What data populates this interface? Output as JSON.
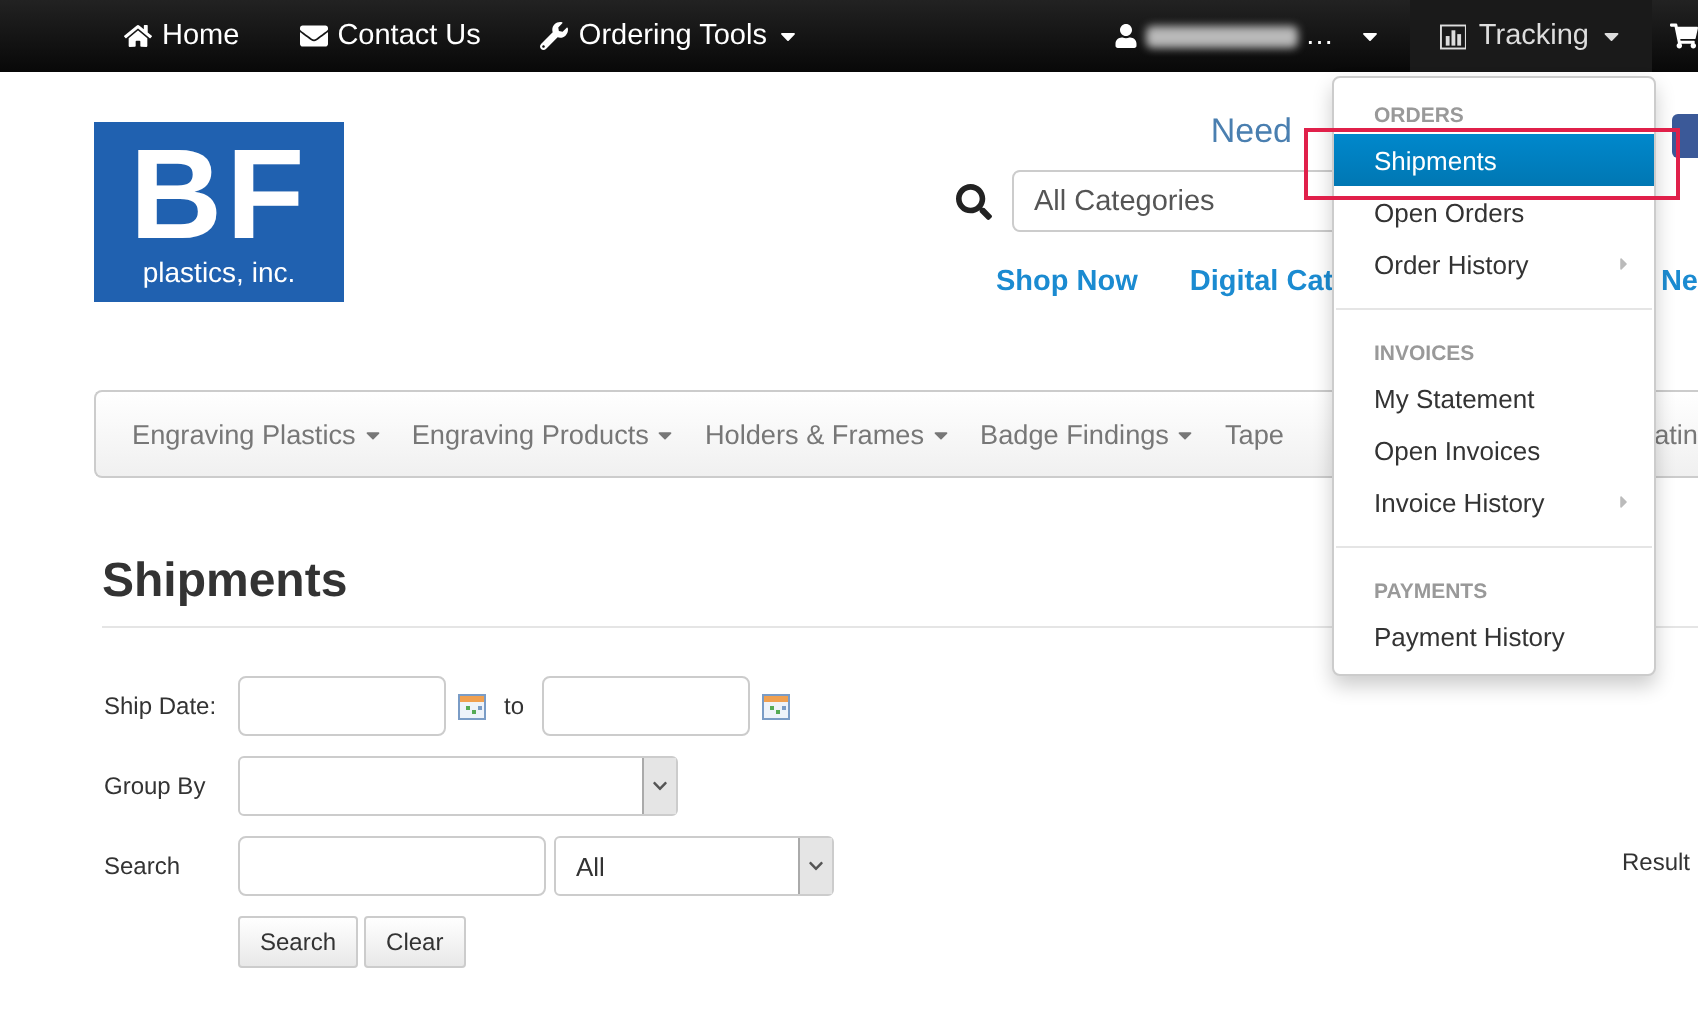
{
  "top_nav": {
    "left": [
      {
        "label": "Home",
        "caret": false
      },
      {
        "label": "Contact Us",
        "caret": false
      },
      {
        "label": "Ordering Tools",
        "caret": true
      }
    ],
    "user": {
      "name": "…"
    },
    "tracking": {
      "label": "Tracking",
      "expanded": true
    }
  },
  "header": {
    "logo": {
      "mark": "BF",
      "name": "plastics, inc."
    },
    "notice": "Need",
    "search_select": "All Categories",
    "links": [
      {
        "label": "Shop Now"
      },
      {
        "label": "Digital Cat"
      },
      {
        "label": "Ne"
      }
    ]
  },
  "category_nav": {
    "items": [
      {
        "label": "Engraving Plastics",
        "caret": true
      },
      {
        "label": "Engraving Products",
        "caret": true
      },
      {
        "label": "Holders & Frames",
        "caret": true
      },
      {
        "label": "Badge Findings",
        "caret": true
      },
      {
        "label": "Tape",
        "caret": false
      },
      {
        "label": "atin",
        "caret": false
      }
    ]
  },
  "tracking_menu": {
    "sections": [
      {
        "heading": "ORDERS",
        "items": [
          {
            "label": "Shipments",
            "selected": true,
            "submenu": false
          },
          {
            "label": "Open Orders",
            "selected": false,
            "submenu": false
          },
          {
            "label": "Order History",
            "selected": false,
            "submenu": true
          }
        ]
      },
      {
        "heading": "INVOICES",
        "items": [
          {
            "label": "My Statement",
            "selected": false,
            "submenu": false
          },
          {
            "label": "Open Invoices",
            "selected": false,
            "submenu": false
          },
          {
            "label": "Invoice History",
            "selected": false,
            "submenu": true
          }
        ]
      },
      {
        "heading": "PAYMENTS",
        "items": [
          {
            "label": "Payment History",
            "selected": false,
            "submenu": false
          }
        ]
      }
    ]
  },
  "page": {
    "title": "Shipments",
    "ship_date": {
      "label": "Ship Date:",
      "to": "to"
    },
    "group_by": {
      "label": "Group By"
    },
    "search": {
      "label": "Search",
      "scope": "All"
    },
    "buttons": [
      "Search",
      "Clear"
    ],
    "results": "Result"
  }
}
